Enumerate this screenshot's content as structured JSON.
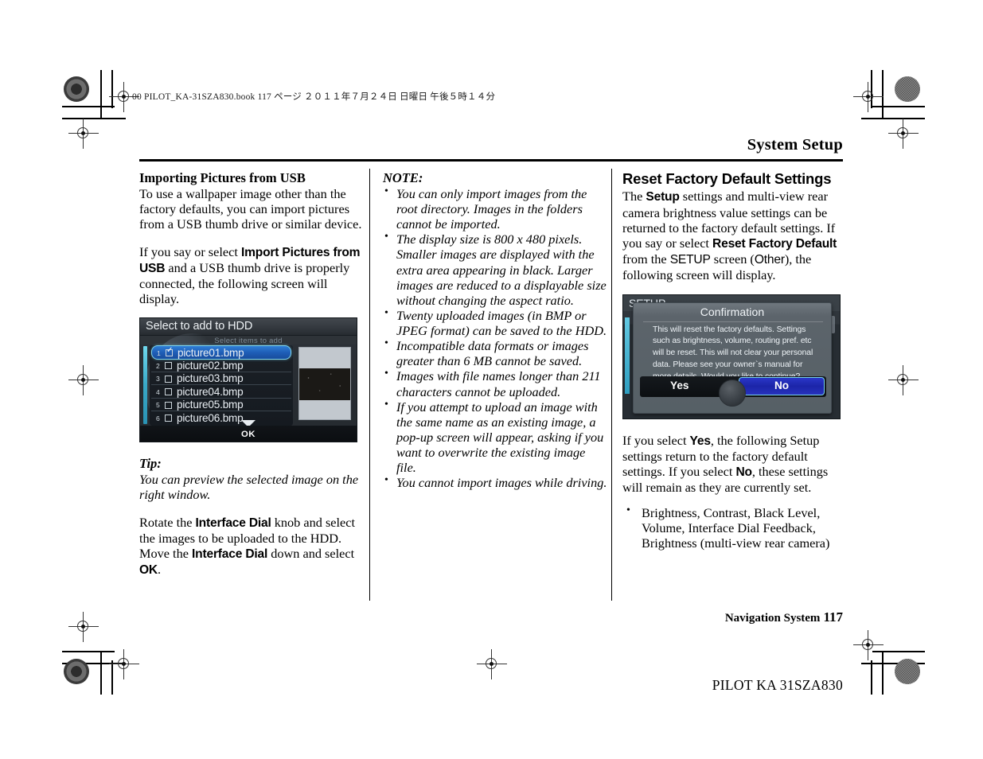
{
  "print_marks": {
    "book_info": "00 PILOT_KA-31SZA830.book   117 ページ   ２０１１年７月２４日   日曜日   午後５時１４分"
  },
  "header": {
    "title": "System Setup"
  },
  "column1": {
    "heading": "Importing Pictures from USB",
    "para1": "To use a wallpaper image other than the factory defaults, you can import pictures from a USB thumb drive or similar device.",
    "para2_a": "If you say or select ",
    "para2_bold": "Import Pictures from USB",
    "para2_b": " and a USB thumb drive is properly connected, the following screen will display.",
    "screenshot": {
      "title": "Select to add to HDD",
      "subtitle": "Select items to add",
      "rows": [
        {
          "num": "1",
          "name": "picture01.bmp",
          "checked": true,
          "selected": true
        },
        {
          "num": "2",
          "name": "picture02.bmp",
          "checked": false,
          "selected": false
        },
        {
          "num": "3",
          "name": "picture03.bmp",
          "checked": false,
          "selected": false
        },
        {
          "num": "4",
          "name": "picture04.bmp",
          "checked": false,
          "selected": false
        },
        {
          "num": "5",
          "name": "picture05.bmp",
          "checked": false,
          "selected": false
        },
        {
          "num": "6",
          "name": "picture06.bmp",
          "checked": false,
          "selected": false
        }
      ],
      "ok_label": "OK"
    },
    "tip_title": "Tip:",
    "tip_body": "You can preview the selected image on the right window.",
    "para3_a": "Rotate the ",
    "para3_bold1": "Interface Dial",
    "para3_b": " knob and select the images to be uploaded to the HDD. Move the ",
    "para3_bold2": "Interface Dial",
    "para3_c": " down and select ",
    "para3_bold3": "OK",
    "para3_d": "."
  },
  "column2": {
    "note_title": "NOTE:",
    "notes": [
      "You can only import images from the root directory. Images in the folders cannot be imported.",
      "The display size is 800 x 480 pixels. Smaller images are displayed with the extra area appearing in black. Larger images are reduced to a displayable size without changing the aspect ratio.",
      "Twenty uploaded images (in BMP or JPEG format) can be saved to the HDD.",
      "Incompatible data formats or images greater than 6 MB cannot be saved.",
      "Images with file names longer than 211 characters cannot be uploaded.",
      "If you attempt to upload an image with the same name as an existing image, a pop-up screen will appear, asking if you want to overwrite the existing image file.",
      "You cannot import images while driving."
    ]
  },
  "column3": {
    "heading": "Reset Factory Default Settings",
    "para1_a": "The ",
    "para1_bold1": "Setup",
    "para1_b": " settings and multi-view rear camera brightness value settings can be returned to the factory default settings. If you say or select ",
    "para1_bold2": "Reset Factory Default",
    "para1_c": " from the ",
    "para1_sans": "SETUP",
    "para1_d": " screen (",
    "para1_sans2": "Other",
    "para1_e": "), the following screen will display.",
    "screenshot": {
      "background_label": "SETUP",
      "dialog_title": "Confirmation",
      "dialog_text": "This will reset the factory defaults. Settings such as brightness, volume, routing pref. etc will be reset. This will not clear your personal data. Please see your owner`s manual for more details. Would you like to continue?",
      "yes_label": "Yes",
      "no_label": "No",
      "selected_button": "No"
    },
    "para2_a": "If you select ",
    "para2_bold1": "Yes",
    "para2_b": ", the following Setup settings return to the factory default settings. If you select ",
    "para2_bold2": "No",
    "para2_c": ", these settings will remain as they are currently set.",
    "bullets": [
      "Brightness, Contrast, Black Level, Volume, Interface Dial Feedback, Brightness (multi-view rear camera)"
    ]
  },
  "footer": {
    "section": "Navigation System",
    "page_number": "117",
    "model_code": "PILOT KA  31SZA830"
  }
}
